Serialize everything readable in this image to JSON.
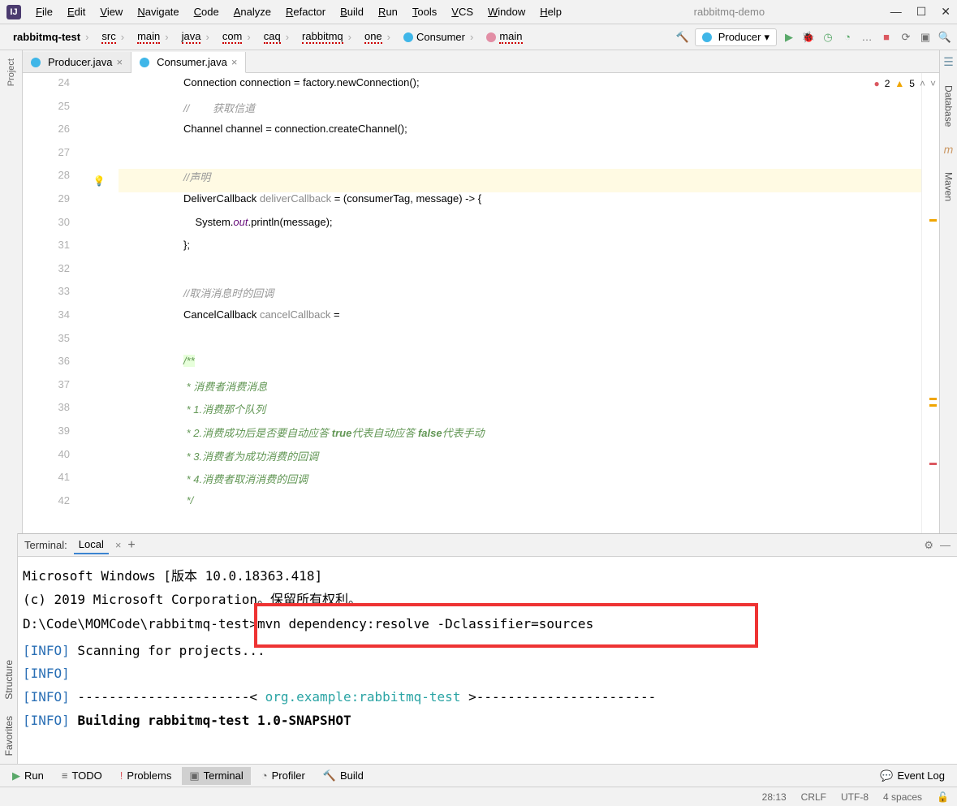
{
  "title": {
    "project": "rabbitmq-demo"
  },
  "menu": [
    "File",
    "Edit",
    "View",
    "Navigate",
    "Code",
    "Analyze",
    "Refactor",
    "Build",
    "Run",
    "Tools",
    "VCS",
    "Window",
    "Help"
  ],
  "breadcrumb": [
    {
      "label": "rabbitmq-test",
      "bold": true
    },
    {
      "label": "src",
      "squiggle": true
    },
    {
      "label": "main",
      "squiggle": true
    },
    {
      "label": "java",
      "squiggle": true
    },
    {
      "label": "com",
      "squiggle": true
    },
    {
      "label": "caq",
      "squiggle": true
    },
    {
      "label": "rabbitmq",
      "squiggle": true
    },
    {
      "label": "one",
      "squiggle": true
    },
    {
      "label": "Consumer",
      "icon": "c"
    },
    {
      "label": "main",
      "icon": "m",
      "squiggle": true
    }
  ],
  "runConfig": {
    "label": "Producer",
    "icon": "c"
  },
  "leftTools": [
    "Project"
  ],
  "leftTools2": [
    "Structure",
    "Favorites"
  ],
  "rightTools": [
    "Database",
    "Maven"
  ],
  "tabs": [
    {
      "label": "Producer.java",
      "active": false
    },
    {
      "label": "Consumer.java",
      "active": true
    }
  ],
  "inspections": {
    "errors": "2",
    "warnings": "5"
  },
  "code": {
    "start": 24,
    "lines": [
      {
        "n": 24,
        "html": "Connection connection = factory.newConnection();"
      },
      {
        "n": 25,
        "html": "<span class='comment'>//        获取信道</span>",
        "pre": "//"
      },
      {
        "n": 26,
        "html": "Channel channel = connection.createChannel();"
      },
      {
        "n": 27,
        "html": ""
      },
      {
        "n": 28,
        "html": "<span class='comment'>//声明</span>",
        "hl": true,
        "bulb": true
      },
      {
        "n": 29,
        "html": "DeliverCallback <span class='var'>deliverCallback</span> = (consumerTag, message) -> {"
      },
      {
        "n": 30,
        "html": "    System.<span class='field'>out</span>.println(message);"
      },
      {
        "n": 31,
        "html": "};"
      },
      {
        "n": 32,
        "html": ""
      },
      {
        "n": 33,
        "html": "<span class='comment'>//取消消息时的回调</span>"
      },
      {
        "n": 34,
        "html": "CancelCallback <span class='var'>cancelCallback</span> ="
      },
      {
        "n": 35,
        "html": ""
      },
      {
        "n": 36,
        "html": "<span class='doc docbg'>/**</span>"
      },
      {
        "n": 37,
        "html": "<span class='doc'> * 消费者消费消息</span>"
      },
      {
        "n": 38,
        "html": "<span class='doc'> * 1.消费那个队列</span>"
      },
      {
        "n": 39,
        "html": "<span class='doc'> * 2.消费成功后是否要自动应答 <span class='docbold'>true</span>代表自动应答 <span class='docbold'>false</span>代表手动</span>"
      },
      {
        "n": 40,
        "html": "<span class='doc'> * 3.消费者为成功消费的回调</span>"
      },
      {
        "n": 41,
        "html": "<span class='doc'> * 4.消费者取消消费的回调</span>"
      },
      {
        "n": 42,
        "html": "<span class='doc'> */</span>"
      }
    ]
  },
  "terminal": {
    "label": "Terminal:",
    "tab": "Local",
    "lines": [
      "Microsoft Windows [版本 10.0.18363.418]",
      "(c) 2019 Microsoft Corporation。保留所有权利。",
      "",
      {
        "prompt": "D:\\Code\\MOMCode\\rabbitmq-test>",
        "cmd": "mvn dependency:resolve -Dclassifier=sources",
        "boxed": true
      },
      {
        "info": true,
        "text": "[INFO] Scanning for projects..."
      },
      {
        "info": true,
        "text": "[INFO]"
      },
      {
        "info": true,
        "pre": "[INFO] ----------------------< ",
        "link": "org.example:rabbitmq-test",
        "post": " >-----------------------"
      },
      {
        "info": true,
        "pre": "[INFO] ",
        "bold": "Building rabbitmq-test 1.0-SNAPSHOT"
      }
    ]
  },
  "bottomTools": [
    {
      "label": "Run",
      "icon": "▶",
      "color": "#59a869"
    },
    {
      "label": "TODO",
      "icon": "≡"
    },
    {
      "label": "Problems",
      "icon": "!",
      "color": "#db5860"
    },
    {
      "label": "Terminal",
      "icon": "▣",
      "active": true
    },
    {
      "label": "Profiler",
      "icon": "◔"
    },
    {
      "label": "Build",
      "icon": "🔨"
    }
  ],
  "eventLog": "Event Log",
  "status": {
    "pos": "28:13",
    "sep": "CRLF",
    "enc": "UTF-8",
    "indent": "4 spaces"
  }
}
